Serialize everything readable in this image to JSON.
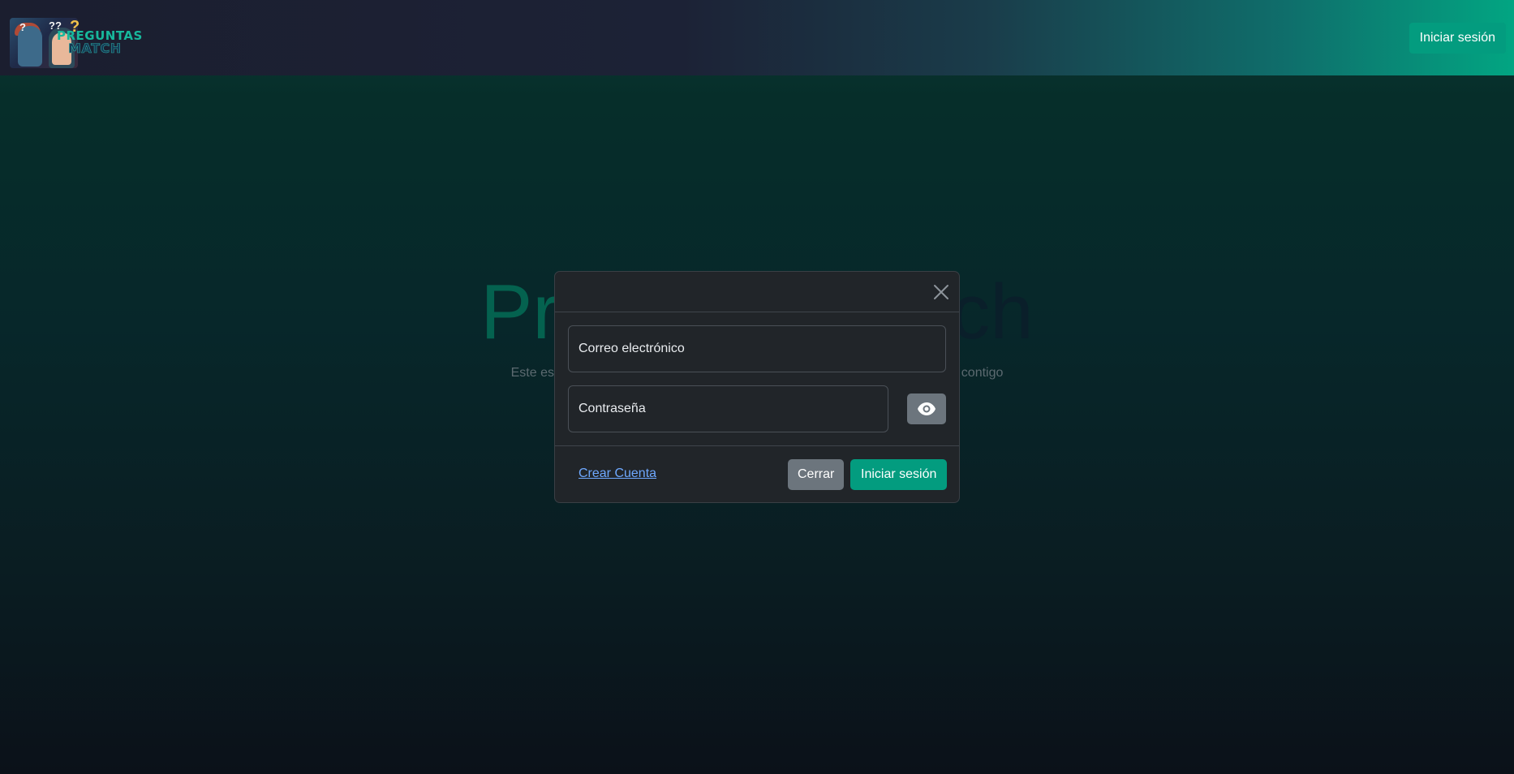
{
  "navbar": {
    "logo": {
      "line1": "PREGUNTAS",
      "line2": "MATCH"
    },
    "login_label": "Iniciar sesión"
  },
  "hero": {
    "title_start": "Pr",
    "title_end": "ch",
    "subtitle_start": "Este es un",
    "subtitle_end": "rdo contigo"
  },
  "modal": {
    "email_placeholder": "Correo electrónico",
    "password_placeholder": "Contraseña",
    "create_account_label": "Crear Cuenta",
    "close_label": "Cerrar",
    "login_label": "Iniciar sesión"
  },
  "colors": {
    "accent": "#039c7f",
    "secondary": "#6c757d",
    "link": "#6ea8fe",
    "modal_bg": "#212529"
  },
  "icons": {
    "close": "close-icon",
    "toggle_password": "eye-icon"
  }
}
